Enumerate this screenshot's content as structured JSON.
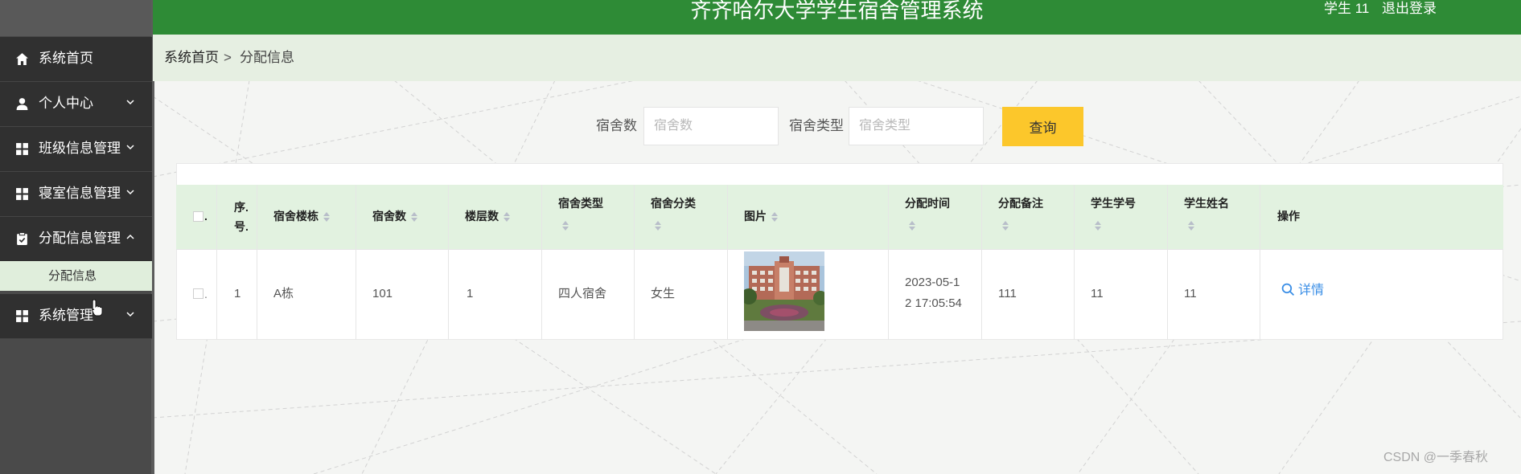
{
  "header": {
    "title": "齐齐哈尔大学学生宿舍管理系统",
    "user": "学生 11",
    "logout": "退出登录",
    "bg_color": "#2e8b36"
  },
  "sidebar": {
    "items": [
      {
        "label": "系统首页",
        "icon": "home-icon"
      },
      {
        "label": "个人中心",
        "icon": "user-icon"
      },
      {
        "label": "班级信息管理",
        "icon": "grid-icon"
      },
      {
        "label": "寝室信息管理",
        "icon": "grid-icon"
      },
      {
        "label": "分配信息管理",
        "icon": "clipboard-icon",
        "expanded": true
      },
      {
        "label": "系统管理",
        "icon": "grid-icon"
      }
    ],
    "submenu": {
      "label": "分配信息",
      "active": true
    }
  },
  "breadcrumb": {
    "home": "系统首页",
    "separator": ">",
    "current": "分配信息"
  },
  "search": {
    "field1_label": "宿舍数",
    "field1_placeholder": "宿舍数",
    "field1_value": "",
    "field2_label": "宿舍类型",
    "field2_placeholder": "宿舍类型",
    "field2_value": "",
    "button": "查询",
    "button_color": "#fcc72b"
  },
  "table": {
    "columns": {
      "check": ".",
      "index_top": "序.",
      "index_bottom": "号.",
      "building": "宿舍楼栋",
      "room": "宿舍数",
      "floor": "楼层数",
      "type": "宿舍类型",
      "category": "宿舍分类",
      "image": "图片",
      "time": "分配时间",
      "note": "分配备注",
      "student_id": "学生学号",
      "student_name": "学生姓名",
      "action": "操作"
    },
    "rows": [
      {
        "index": "1",
        "building": "A栋",
        "room": "101",
        "floor": "1",
        "type": "四人宿舍",
        "category": "女生",
        "image": "dormitory-photo",
        "time_line1": "2023-05-1",
        "time_line2": "2 17:05:54",
        "note": "111",
        "student_id": "11",
        "student_name": "11",
        "action": "详情"
      }
    ],
    "header_bg": "#e2f2e0"
  },
  "watermark": "CSDN @一季春秋"
}
